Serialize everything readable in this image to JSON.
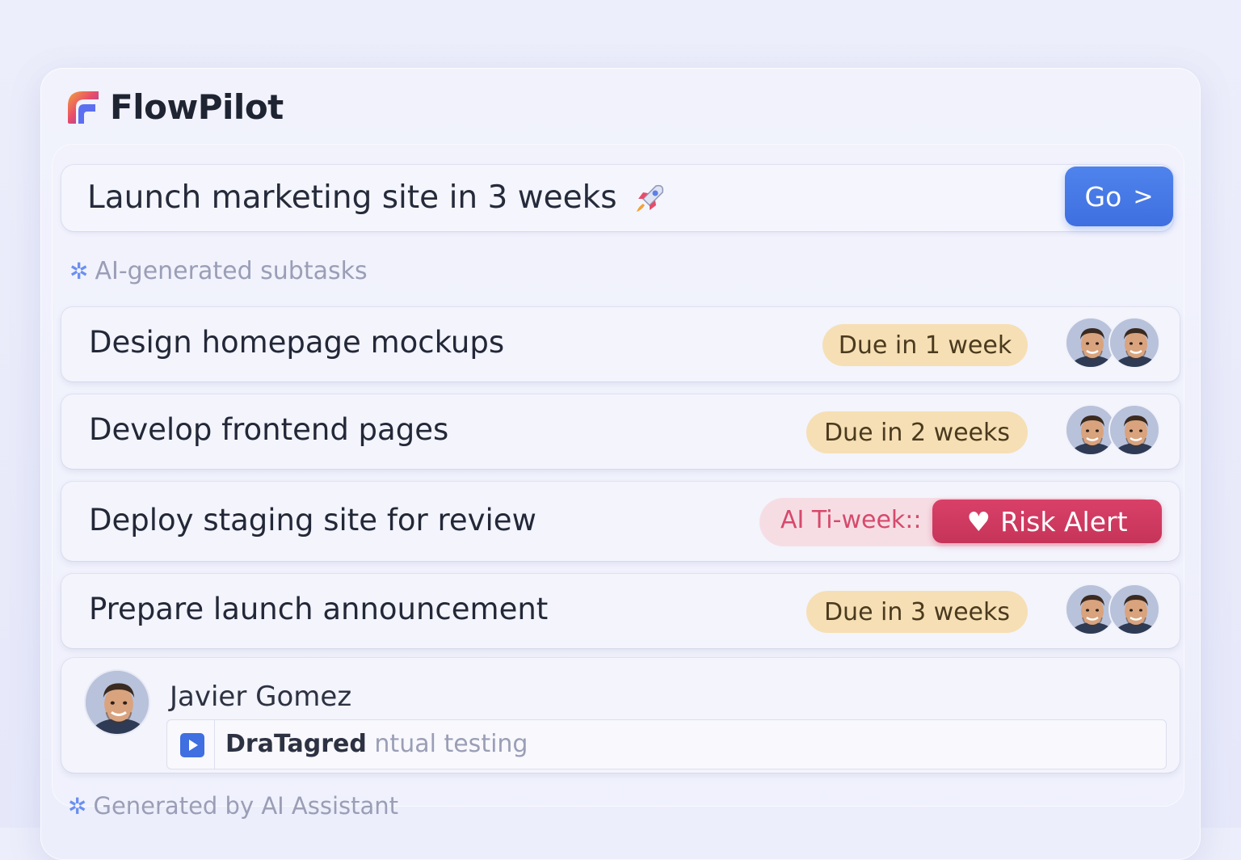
{
  "app": {
    "name": "FlowPilot"
  },
  "goal": {
    "text": "Launch marketing site in 3 weeks",
    "go_label": "Go",
    "go_chevron": ">"
  },
  "subtasks_label": "AI-generated subtasks",
  "tasks": [
    {
      "title": "Design homepage mockups",
      "due": "Due in 1 week"
    },
    {
      "title": "Develop frontend pages",
      "due": "Due in 2 weeks"
    },
    {
      "title": "Deploy staging site for review",
      "ai_text": "AI Ti-week::",
      "risk_label": "Risk Alert"
    },
    {
      "title": "Prepare launch announcement",
      "due": "Due in 3 weeks"
    }
  ],
  "comment": {
    "name": "Javier Gomez",
    "strong": "DraTagred",
    "rest": "ntual testing"
  },
  "footer": "Generated by AI Assistant",
  "colors": {
    "accent": "#3f6fe0",
    "due_bg": "#f6dfb4",
    "risk": "#d23f66"
  }
}
